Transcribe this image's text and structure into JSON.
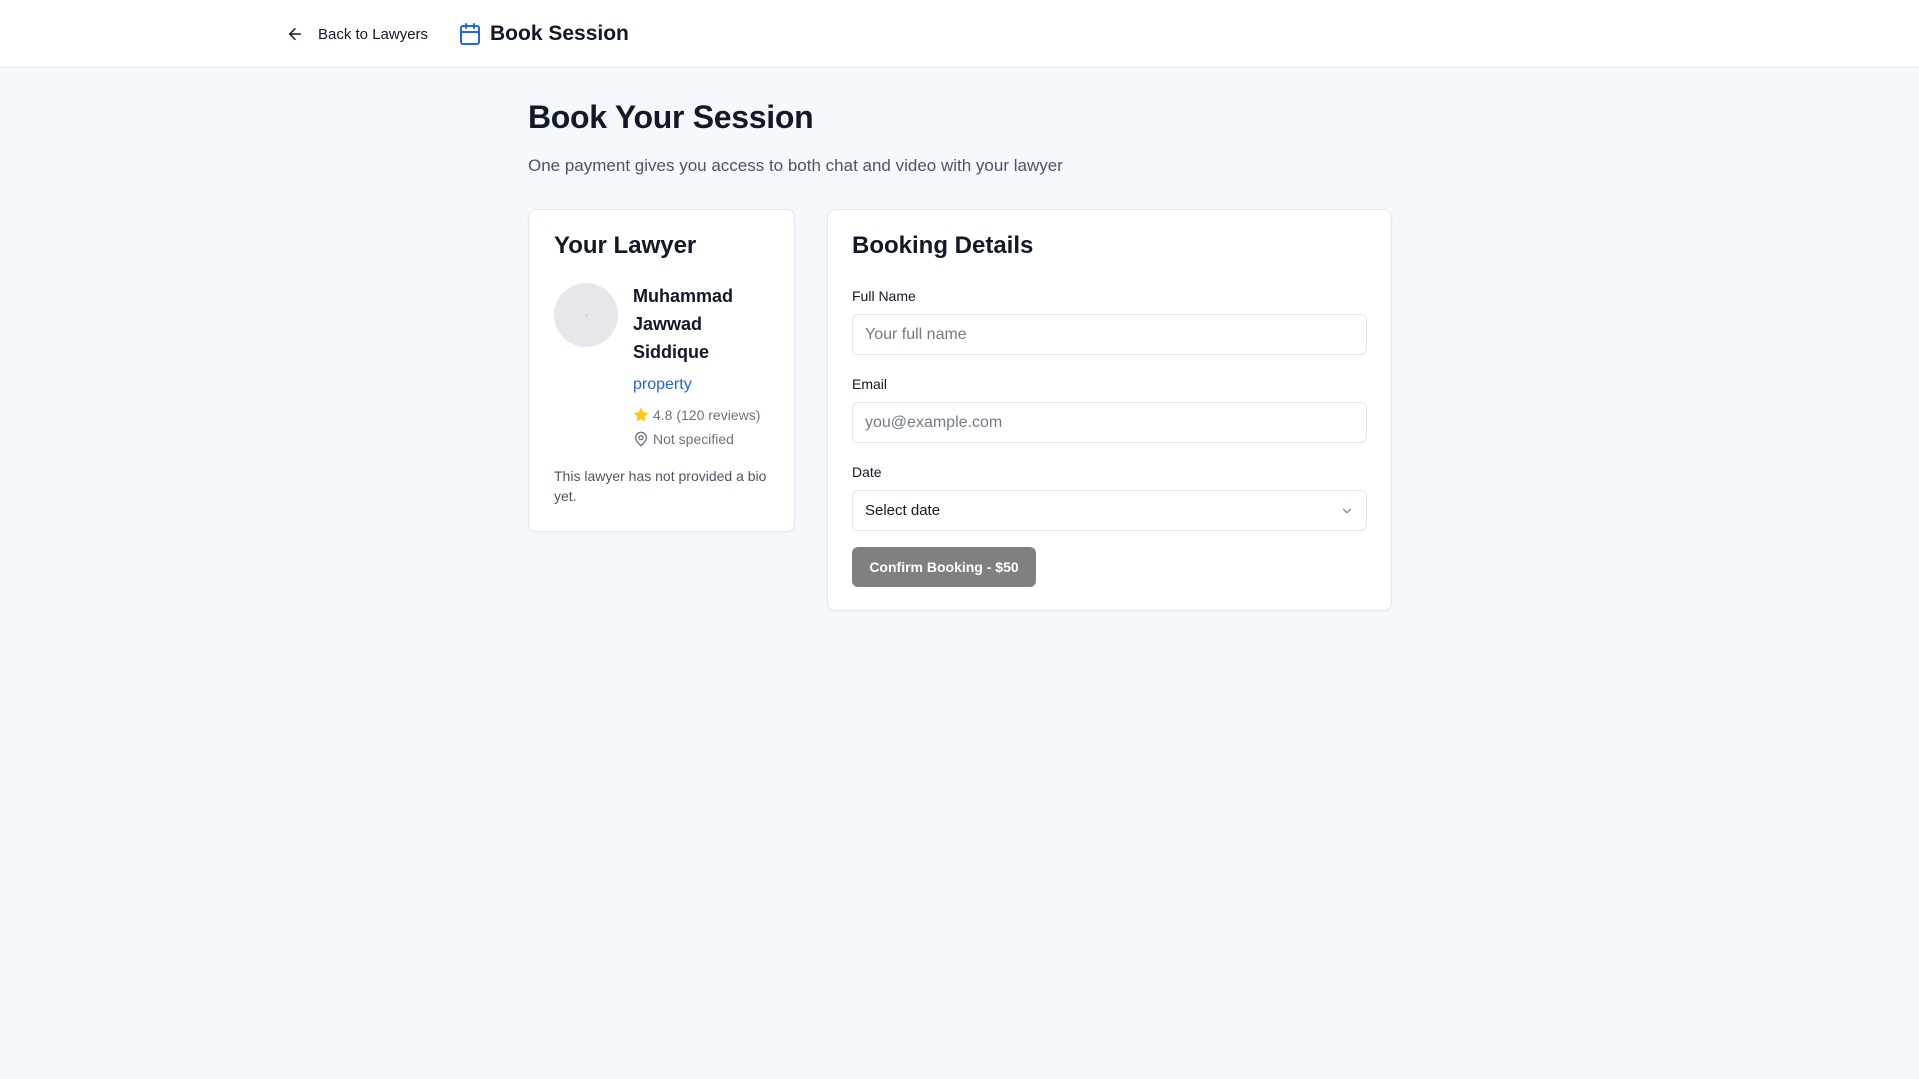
{
  "header": {
    "back_label": "Back to Lawyers",
    "title": "Book Session"
  },
  "page": {
    "title": "Book Your Session",
    "subtitle": "One payment gives you access to both chat and video with your lawyer"
  },
  "lawyer_card": {
    "title": "Your Lawyer",
    "name": "Muhammad Jawwad Siddique",
    "specialty": "property",
    "rating": "4.8 (120 reviews)",
    "location": "Not specified",
    "bio": "This lawyer has not provided a bio yet."
  },
  "booking": {
    "title": "Booking Details",
    "full_name_label": "Full Name",
    "full_name_placeholder": "Your full name",
    "email_label": "Email",
    "email_placeholder": "you@example.com",
    "date_label": "Date",
    "date_value": "Select date",
    "confirm_label": "Confirm Booking - $50"
  },
  "icons": {
    "back": "arrow-left-icon",
    "brand": "calendar-icon",
    "rating": "star-icon",
    "location": "map-pin-icon",
    "select": "chevron-down-icon"
  },
  "colors": {
    "accent": "#2563eb",
    "star": "#facc15",
    "button_disabled": "#808080",
    "background": "#f5f8fd"
  }
}
